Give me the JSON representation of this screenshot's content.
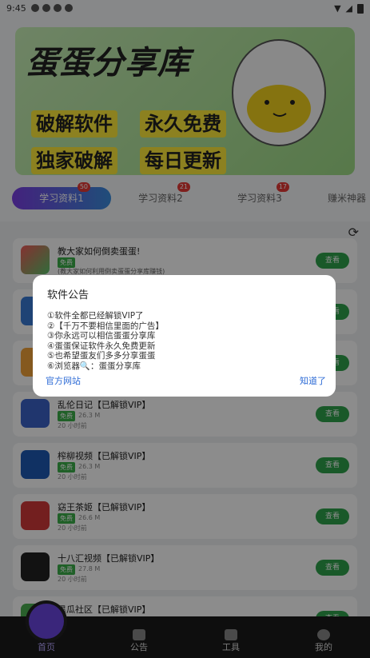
{
  "status": {
    "time": "9:45"
  },
  "banner": {
    "title": "蛋蛋分享库",
    "tags": [
      "破解软件",
      "永久免费",
      "独家破解",
      "每日更新"
    ]
  },
  "tabs": [
    {
      "label": "学习资料1",
      "badge": "50"
    },
    {
      "label": "学习资料2",
      "badge": "21"
    },
    {
      "label": "学习资料3",
      "badge": "17"
    },
    {
      "label": "赚米神器",
      "badge": ""
    }
  ],
  "list": [
    {
      "title": "教大家如何倒卖蛋蛋!",
      "free": "免费",
      "size": "",
      "time": "",
      "desc": "(教大家如何利用倒卖蛋蛋分享库赚钱)",
      "btn": "查看"
    },
    {
      "title": "",
      "free": "",
      "size": "",
      "time": "",
      "desc": "",
      "btn": "查看"
    },
    {
      "title": "",
      "free": "",
      "size": "",
      "time": "",
      "desc": "",
      "btn": "查看"
    },
    {
      "title": "乱伦日记【已解锁VIP】",
      "free": "免费",
      "size": "26.3 M",
      "time": "20 小时前",
      "desc": "",
      "btn": "查看"
    },
    {
      "title": "榨柳视频【已解锁VIP】",
      "free": "免费",
      "size": "26.3 M",
      "time": "20 小时前",
      "desc": "",
      "btn": "查看"
    },
    {
      "title": "窈王茶姬【已解锁VIP】",
      "free": "免费",
      "size": "26.6 M",
      "time": "20 小时前",
      "desc": "",
      "btn": "查看"
    },
    {
      "title": "十八汇视频【已解锁VIP】",
      "free": "免费",
      "size": "27.8 M",
      "time": "20 小时前",
      "desc": "",
      "btn": "查看"
    },
    {
      "title": "黑瓜社区【已解锁VIP】",
      "free": "",
      "size": "",
      "time": "",
      "desc": "",
      "btn": "查看"
    }
  ],
  "nav": [
    {
      "label": "首页"
    },
    {
      "label": "公告"
    },
    {
      "label": "工具"
    },
    {
      "label": "我的"
    }
  ],
  "dialog": {
    "title": "软件公告",
    "lines": [
      "①软件全都已经解锁VIP了",
      "②【千万不要相信里面的广告】",
      "③你永远可以相信蛋蛋分享库",
      "④蛋蛋保证软件永久免费更新",
      "⑤也希望蛋友们多多分享蛋蛋",
      "⑥浏览器🔍：蛋蛋分享库"
    ],
    "left_btn": "官方网站",
    "right_btn": "知道了"
  }
}
